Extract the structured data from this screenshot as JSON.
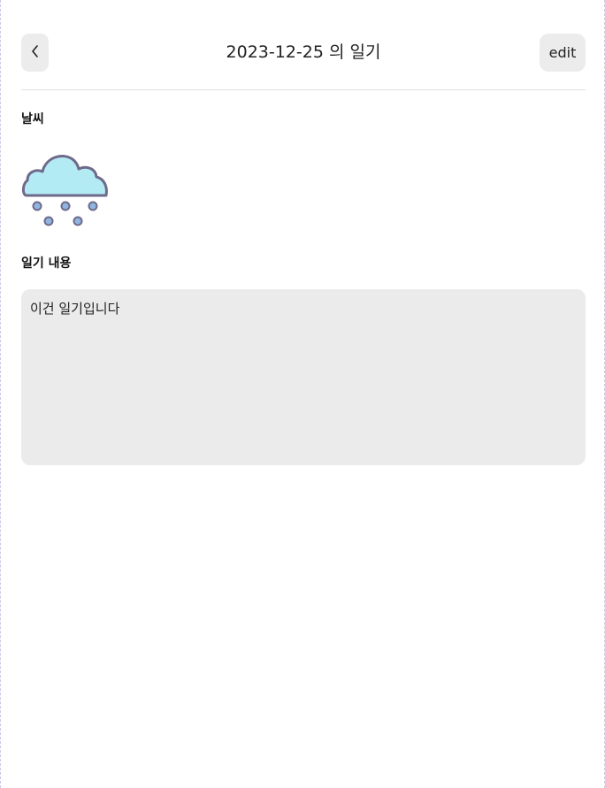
{
  "header": {
    "title": "2023-12-25 의 일기",
    "back_icon": "chevron-left-icon",
    "edit_label": "edit"
  },
  "weather": {
    "label": "날씨",
    "icon": "snow-cloud-icon",
    "colors": {
      "cloud_fill": "#b3ebf4",
      "outline": "#6f6a8a",
      "snow_fill": "#8fb5e0"
    }
  },
  "diary": {
    "label": "일기 내용",
    "content": "이건 일기입니다"
  },
  "colors": {
    "button_bg": "#ececec",
    "content_bg": "#ebebeb",
    "divider": "#e2e2e2"
  }
}
